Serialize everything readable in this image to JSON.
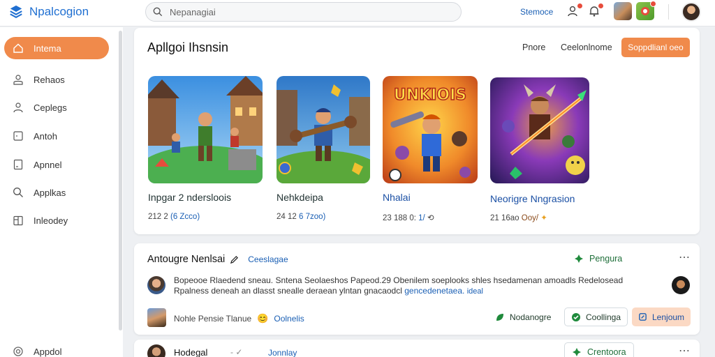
{
  "app": {
    "title": "Npalcogion"
  },
  "search": {
    "placeholder": "Nepanagiai"
  },
  "topbar": {
    "link": "Stemoce"
  },
  "sidebar": {
    "items": [
      {
        "label": "Intema",
        "icon": "home-icon",
        "active": true
      },
      {
        "label": "Rehaos",
        "icon": "user-icon",
        "active": false
      },
      {
        "label": "Ceplegs",
        "icon": "person-icon",
        "active": false
      },
      {
        "label": "Antoh",
        "icon": "square-icon",
        "active": false
      },
      {
        "label": "Apnnel",
        "icon": "document-icon",
        "active": false
      },
      {
        "label": "Applkas",
        "icon": "search-icon",
        "active": false
      },
      {
        "label": "Inleodey",
        "icon": "clipboard-icon",
        "active": false
      }
    ],
    "footer": {
      "label": "Appdol",
      "icon": "settings-icon"
    }
  },
  "featured": {
    "title": "Apllgoi Ihsnsin",
    "link1": "Pnore",
    "link2": "Ceelonlnome",
    "button": "Soppdlianl oeo",
    "games": [
      {
        "title": "Inpgar 2 ndersloois",
        "meta_plain": "212 2 ",
        "meta_blue": "(6 Zcco)",
        "art": "village"
      },
      {
        "title": "Nehkdeipa",
        "meta_plain": "24 12 ",
        "meta_blue": "6 7zoo)",
        "art": "hero"
      },
      {
        "title": "Nhalai",
        "meta_plain": "23 188 0:",
        "meta_blue": " 1/",
        "meta_tail": "⟲",
        "art": "arcade",
        "art_text": "UNKIOIS"
      },
      {
        "title": "Neorigre Nngrasion",
        "meta_plain": "21 16ao ",
        "meta_blue": "Ooy/",
        "meta_tail": "✦",
        "art": "fantasy"
      }
    ]
  },
  "post1": {
    "title": "Antougre Nenlsai",
    "tag": "Ceeslagae",
    "right_tag": "Pengura",
    "body_line1": "Bopeooe Rlaedend sneau. Sntena Seolaeshos Papeod.29 Obenilem soeplooks shles hsedamenan amoadls Redelosead",
    "body_line2_plain": "Rpalness deneah an dlasst snealle deraean ylntan gnacaodcl",
    "body_line2_blue": "gencedenetaea.",
    "body_line2_tail": "ideal",
    "meta_name": "Nohle Pensie Tlanue",
    "meta_blue": "Oolnelis",
    "actions": {
      "a1": "Nodanogre",
      "a2": "Coollinga",
      "a3": "Lenjoum"
    }
  },
  "post2": {
    "title": "Hodegal",
    "tag": "Jonnlay",
    "right_tag": "Crentoora"
  },
  "colors": {
    "accent": "#f08a4b",
    "brand": "#1f6fd1",
    "link": "#1a5fb4",
    "success": "#1f8a3c"
  }
}
